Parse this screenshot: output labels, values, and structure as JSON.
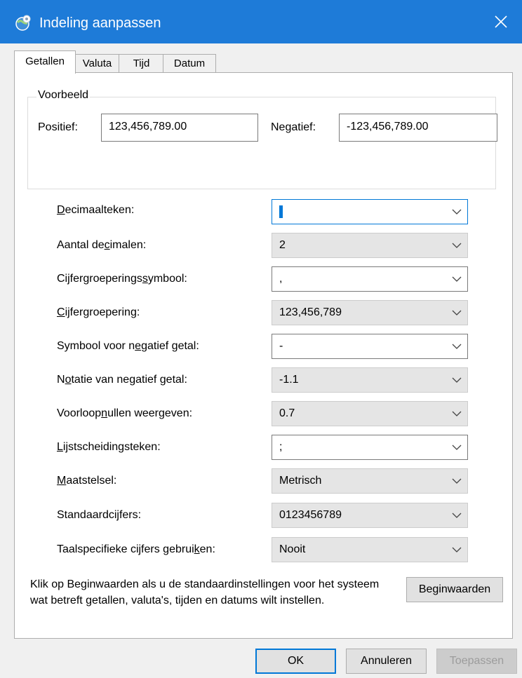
{
  "window": {
    "title": "Indeling aanpassen",
    "icon": "region-globe-icon",
    "accent": "#1e7bd8"
  },
  "tabs": [
    {
      "label": "Getallen",
      "active": true
    },
    {
      "label": "Valuta",
      "active": false
    },
    {
      "label": "Tijd",
      "active": false
    },
    {
      "label": "Datum",
      "active": false
    }
  ],
  "preview": {
    "legend": "Voorbeeld",
    "positive_label": "Positief:",
    "positive_value": "123,456,789.00",
    "negative_label": "Negatief:",
    "negative_value": "-123,456,789.00"
  },
  "settings": [
    {
      "label": "Decimaalteken:",
      "value": ".",
      "kind": "editable"
    },
    {
      "label": "Aantal decimalen:",
      "value": "2",
      "kind": "list"
    },
    {
      "label": "Cijfergroeperingssymbool:",
      "value": ",",
      "kind": "editable"
    },
    {
      "label": "Cijfergroepering:",
      "value": "123,456,789",
      "kind": "list"
    },
    {
      "label": "Symbool voor negatief getal:",
      "value": "-",
      "kind": "editable"
    },
    {
      "label": "Notatie van negatief getal:",
      "value": "-1.1",
      "kind": "list"
    },
    {
      "label": "Voorloopnullen weergeven:",
      "value": "0.7",
      "kind": "list"
    },
    {
      "label": "Lijstscheidingsteken:",
      "value": ";",
      "kind": "editable"
    },
    {
      "label": "Maatstelsel:",
      "value": "Metrisch",
      "kind": "list"
    },
    {
      "label": "Standaardcijfers:",
      "value": "0123456789",
      "kind": "list"
    },
    {
      "label": "Taalspecifieke cijfers gebruiken:",
      "value": "Nooit",
      "kind": "list"
    }
  ],
  "info": {
    "text": "Klik op Beginwaarden als u de standaardinstellingen voor het systeem wat betreft getallen, valuta's, tijden en datums wilt instellen.",
    "reset_button": "Beginwaarden"
  },
  "footer": {
    "ok": "OK",
    "cancel": "Annuleren",
    "apply": "Toepassen"
  }
}
